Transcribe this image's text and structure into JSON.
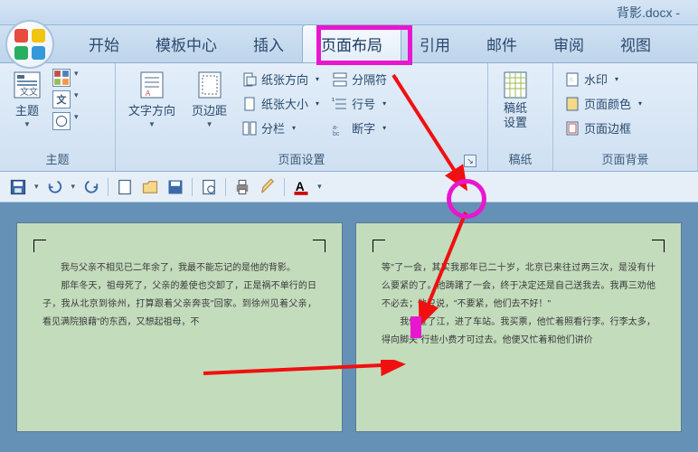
{
  "title": "背影.docx -",
  "tabs": {
    "start": "开始",
    "template": "模板中心",
    "insert": "插入",
    "layout": "页面布局",
    "references": "引用",
    "mail": "邮件",
    "review": "审阅",
    "view": "视图"
  },
  "groups": {
    "theme": {
      "label": "主题",
      "btn": "主题"
    },
    "page_setup": {
      "label": "页面设置",
      "text_direction": "文字方向",
      "margins": "页边距",
      "orientation": "纸张方向",
      "size": "纸张大小",
      "columns": "分栏",
      "breaks": "分隔符",
      "line_numbers": "行号",
      "hyphenation": "断字"
    },
    "manuscript": {
      "label": "稿纸",
      "btn": "稿纸\n设置"
    },
    "background": {
      "label": "页面背景",
      "watermark": "水印",
      "color": "页面颜色",
      "border": "页面边框"
    }
  },
  "pages": {
    "left": "　　我与父亲不相见已二年余了，我最不能忘记的是他的背影。\n　　那年冬天，祖母死了，父亲的差使也交卸了，正是祸不单行的日子，我从北京到徐州，打算跟着父亲奔丧\"回家。到徐州见着父亲，看见满院狼藉\"的东西，又想起祖母，不",
    "right": "等\"了一会，其实我那年已二十岁，北京已来往过两三次，是没有什么要紧的了。他踌躇了一会，终于决定还是自己送我去。我再三劝他不必去；他只说，\"不要紧，他们去不好！\"\n　　我们过了江，进了车站。我买票，他忙着照看行李。行李太多，得向脚夫\"行些小费才可过去。他便又忙着和他们讲价"
  }
}
